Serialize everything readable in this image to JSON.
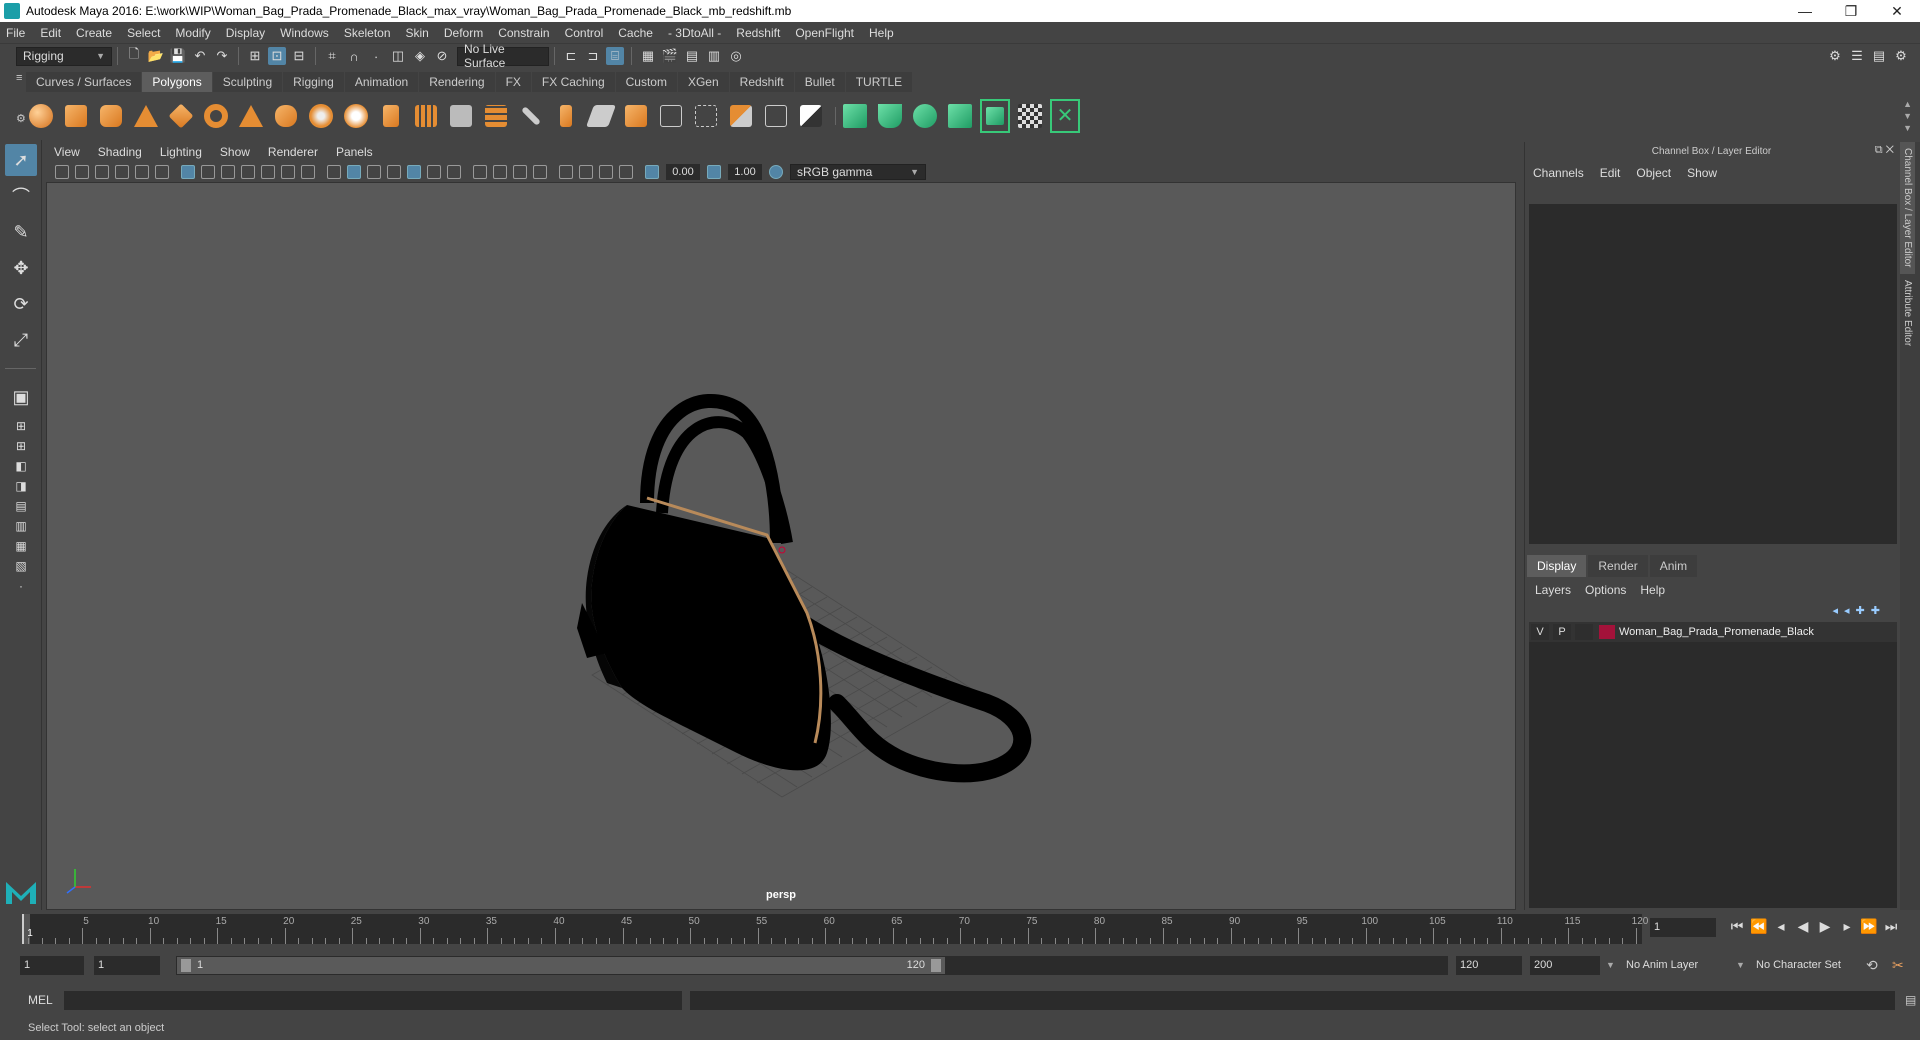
{
  "window": {
    "title": "Autodesk Maya 2016: E:\\work\\WIP\\Woman_Bag_Prada_Promenade_Black_max_vray\\Woman_Bag_Prada_Promenade_Black_mb_redshift.mb"
  },
  "menubar": [
    "File",
    "Edit",
    "Create",
    "Select",
    "Modify",
    "Display",
    "Windows",
    "Skeleton",
    "Skin",
    "Deform",
    "Constrain",
    "Control",
    "Cache",
    "- 3DtoAll -",
    "Redshift",
    "OpenFlight",
    "Help"
  ],
  "status": {
    "mode": "Rigging",
    "live_surface": "No Live Surface"
  },
  "shelf_tabs": [
    "Curves / Surfaces",
    "Polygons",
    "Sculpting",
    "Rigging",
    "Animation",
    "Rendering",
    "FX",
    "FX Caching",
    "Custom",
    "XGen",
    "Redshift",
    "Bullet",
    "TURTLE"
  ],
  "shelf_active": "Polygons",
  "viewport": {
    "menu": [
      "View",
      "Shading",
      "Lighting",
      "Show",
      "Renderer",
      "Panels"
    ],
    "exposure": "0.00",
    "gamma": "1.00",
    "color_space": "sRGB gamma",
    "camera": "persp"
  },
  "channel_box": {
    "title": "Channel Box / Layer Editor",
    "menu": [
      "Channels",
      "Edit",
      "Object",
      "Show"
    ],
    "tabs": [
      "Display",
      "Render",
      "Anim"
    ],
    "active_tab": "Display",
    "layer_menu": [
      "Layers",
      "Options",
      "Help"
    ],
    "layer": {
      "v": "V",
      "p": "P",
      "name": "Woman_Bag_Prada_Promenade_Black",
      "color": "#a3123a"
    }
  },
  "side_tabs": [
    "Channel Box / Layer Editor",
    "Attribute Editor"
  ],
  "timeline": {
    "ticks": [
      1,
      5,
      10,
      15,
      20,
      25,
      30,
      35,
      40,
      45,
      50,
      55,
      60,
      65,
      70,
      75,
      80,
      85,
      90,
      95,
      100,
      105,
      110,
      115,
      120
    ],
    "tick_labels": [
      "5",
      "10",
      "15",
      "20",
      "25",
      "30",
      "35",
      "40",
      "45",
      "50",
      "55",
      "60",
      "65",
      "70",
      "75",
      "80",
      "85",
      "90",
      "95",
      "100",
      "105",
      "110",
      "115",
      "120"
    ],
    "start_label": "1",
    "current_frame": "1"
  },
  "range": {
    "start": "1",
    "inner_start": "1",
    "slider_start": "1",
    "slider_end": "120",
    "end": "120",
    "max_end": "200",
    "anim_layer": "No Anim Layer",
    "character_set": "No Character Set"
  },
  "mel": {
    "label": "MEL"
  },
  "help_line": "Select Tool: select an object"
}
